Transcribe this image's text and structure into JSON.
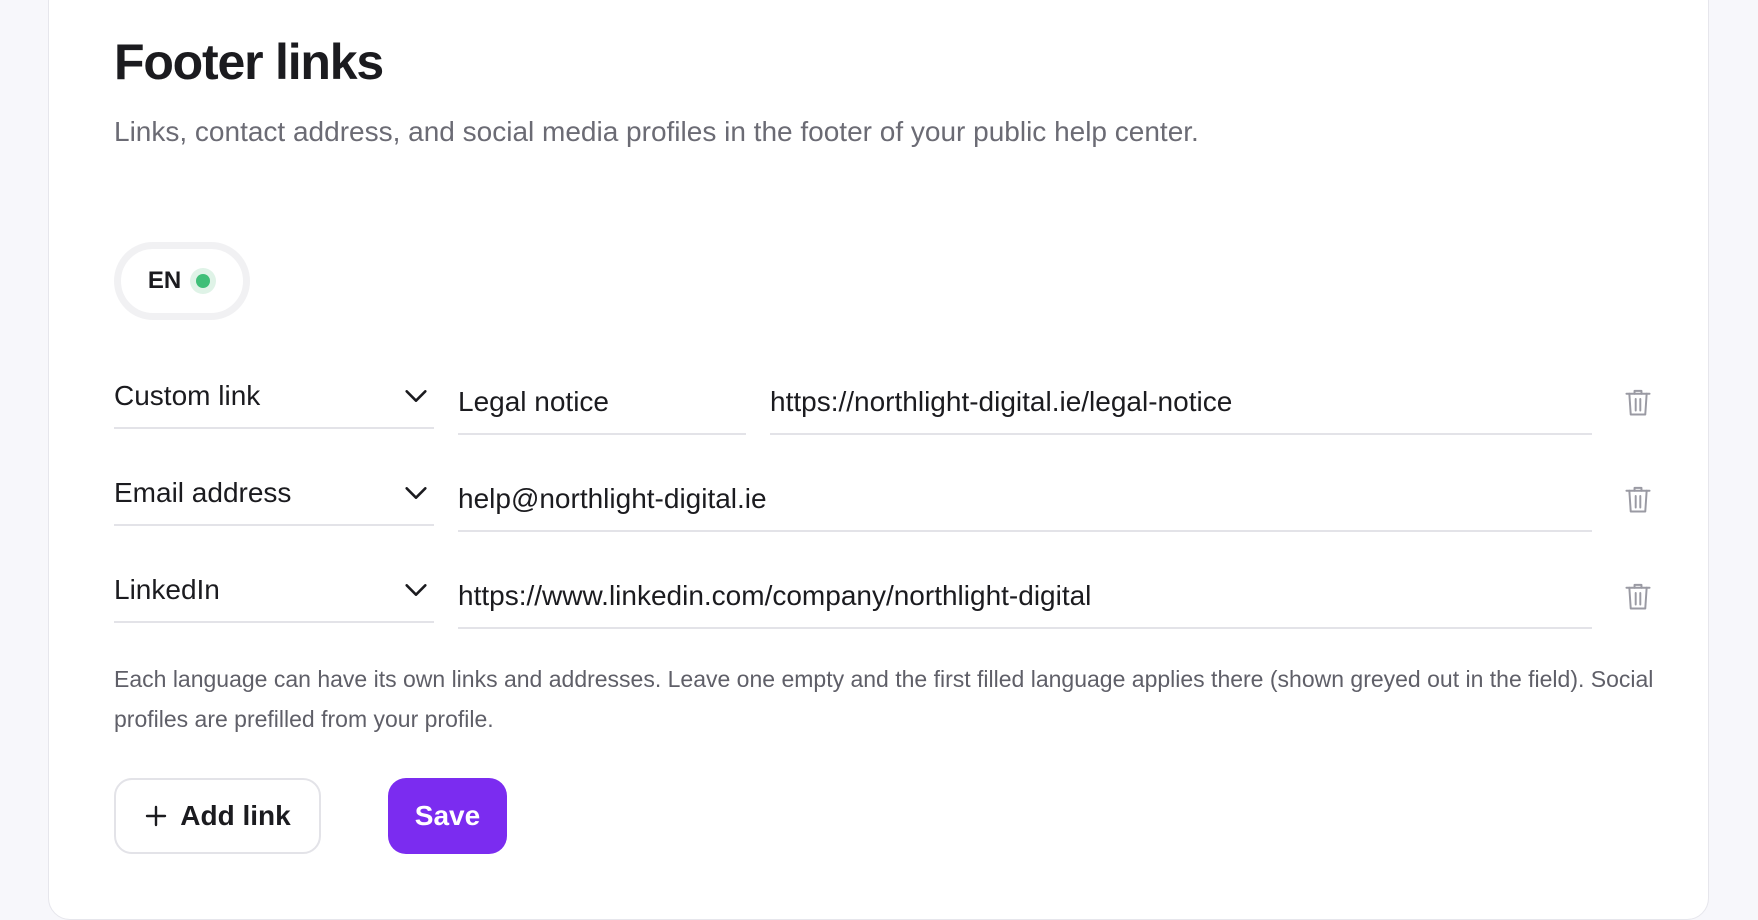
{
  "header": {
    "title": "Footer links",
    "subtitle": "Links, contact address, and social media profiles in the footer of your public help center."
  },
  "language": {
    "code": "EN",
    "status_color": "#3fbf78"
  },
  "rows": [
    {
      "type": "Custom link",
      "label": "Legal notice",
      "url": "https://northlight-digital.ie/legal-notice"
    },
    {
      "type": "Email address",
      "value": "help@northlight-digital.ie"
    },
    {
      "type": "LinkedIn",
      "value": "https://www.linkedin.com/company/northlight-digital"
    }
  ],
  "help_text": "Each language can have its own links and addresses. Leave one empty and the first filled language applies there (shown greyed out in the field). Social profiles are prefilled from your profile.",
  "actions": {
    "add_label": "Add link",
    "save_label": "Save"
  },
  "icons": {
    "chevron": "chevron-down-icon",
    "trash": "trash-icon",
    "plus": "plus-icon"
  },
  "colors": {
    "accent": "#7b2cf0",
    "status_ok": "#3fbf78"
  }
}
